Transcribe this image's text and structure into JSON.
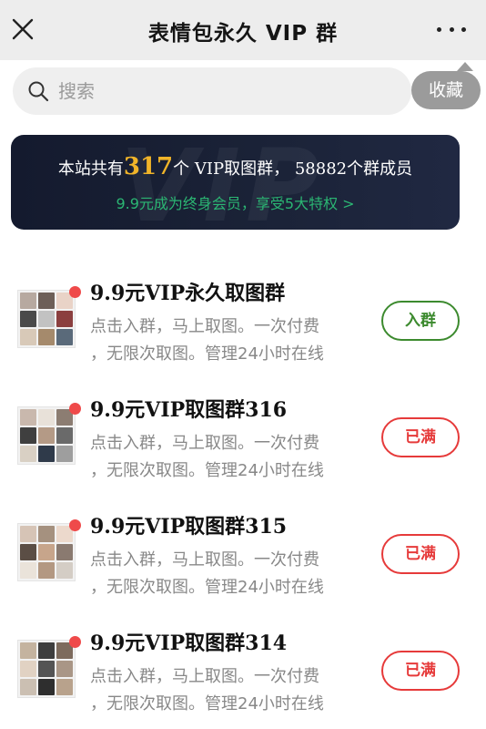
{
  "header": {
    "title": "表情包永久 VIP 群",
    "close_icon": "close-icon",
    "more_icon": "more-dots-icon"
  },
  "search": {
    "placeholder": "搜索",
    "icon": "search-icon"
  },
  "collect": {
    "label": "收藏"
  },
  "banner": {
    "prefix": "本站共有",
    "group_count": "317",
    "middle": "个 VIP取图群，",
    "member_count": "58882",
    "suffix": "个群成员",
    "subtitle": "9.9元成为终身会员，享受5大特权 >",
    "highlight_color": "#f0b429",
    "subtitle_color": "#2bb673"
  },
  "groups": [
    {
      "title": "9.9元VIP永久取图群",
      "desc_line1": "点击入群，马上取图。一次付费",
      "desc_line2": "，无限次取图。管理24小时在线",
      "action": "入群",
      "action_color": "#3c8a2e"
    },
    {
      "title": "9.9元VIP取图群316",
      "desc_line1": "点击入群，马上取图。一次付费",
      "desc_line2": "，无限次取图。管理24小时在线",
      "action": "已满",
      "action_color": "#e63a3a"
    },
    {
      "title": "9.9元VIP取图群315",
      "desc_line1": "点击入群，马上取图。一次付费",
      "desc_line2": "，无限次取图。管理24小时在线",
      "action": "已满",
      "action_color": "#e63a3a"
    },
    {
      "title": "9.9元VIP取图群314",
      "desc_line1": "点击入群，马上取图。一次付费",
      "desc_line2": "，无限次取图。管理24小时在线",
      "action": "已满",
      "action_color": "#e63a3a"
    }
  ]
}
